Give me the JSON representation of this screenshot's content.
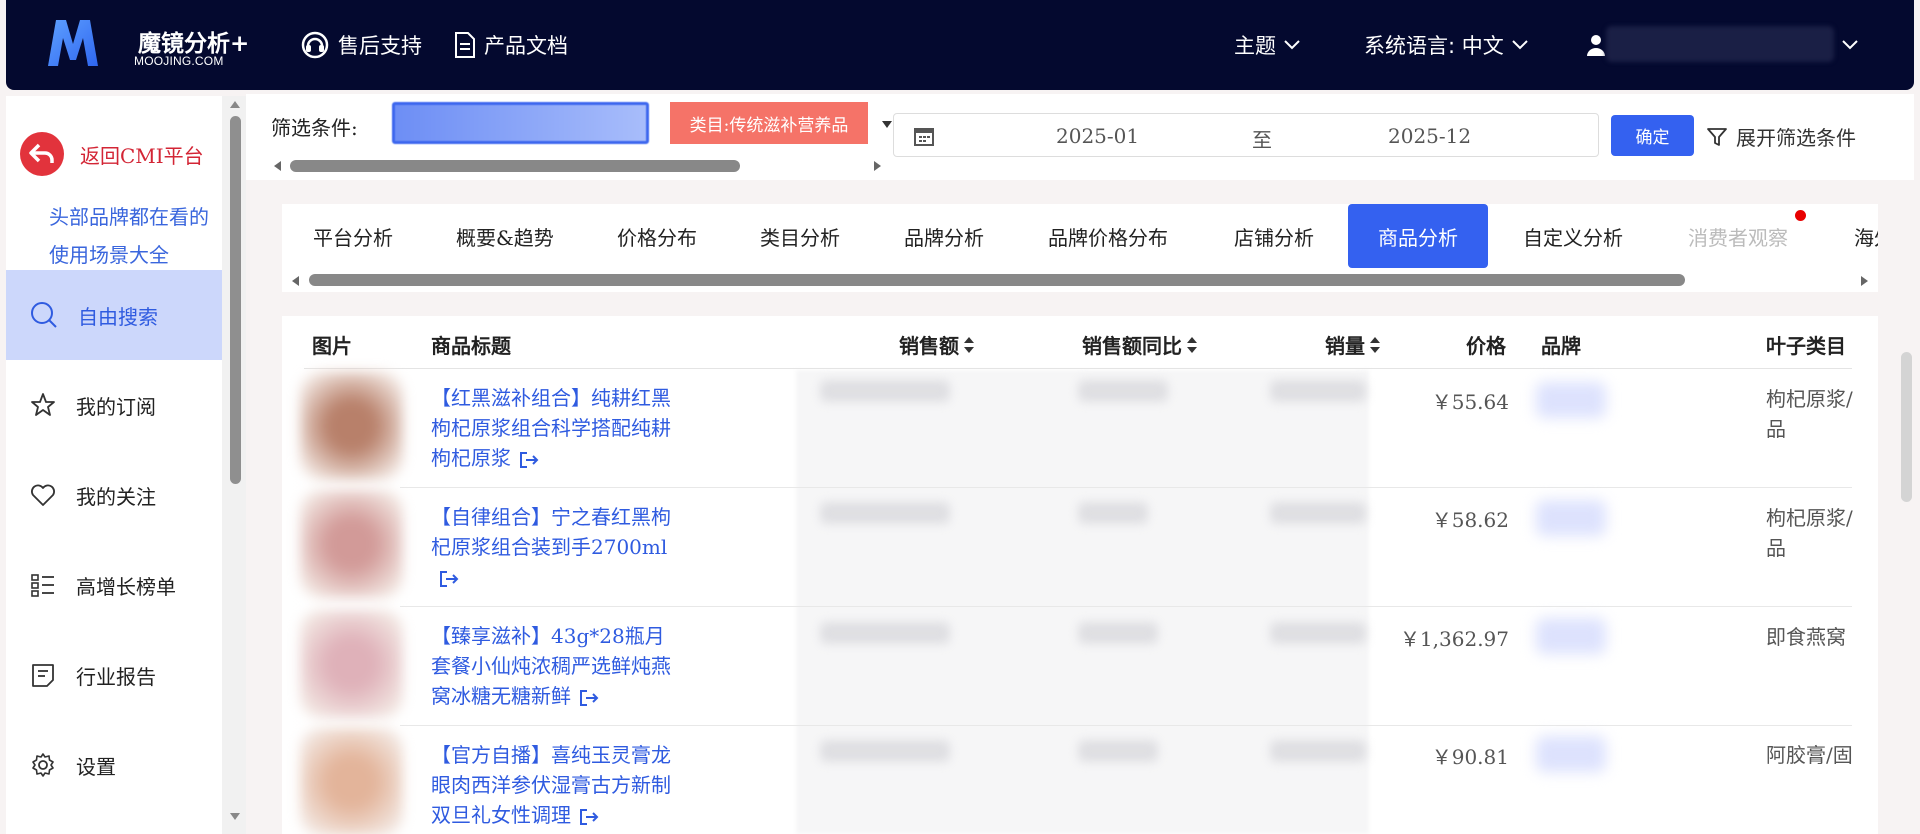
{
  "header": {
    "brand_name": "魔镜分析+",
    "brand_sub": "MOOJING.COM",
    "support": "售后支持",
    "docs": "产品文档",
    "theme": "主题",
    "language": "系统语言: 中文"
  },
  "sidebar": {
    "back": "返回CMI平台",
    "promo_line1": "头部品牌都在看的",
    "promo_line2": "使用场景大全",
    "items": [
      {
        "label": "自由搜索",
        "icon": "search-icon"
      },
      {
        "label": "我的订阅",
        "icon": "star-icon"
      },
      {
        "label": "我的关注",
        "icon": "heart-icon"
      },
      {
        "label": "高增长榜单",
        "icon": "list-icon"
      },
      {
        "label": "行业报告",
        "icon": "report-icon"
      },
      {
        "label": "设置",
        "icon": "gear-icon"
      }
    ]
  },
  "filter": {
    "label": "筛选条件:",
    "tag": "类目:传统滋补营养品",
    "date_start": "2025-01",
    "date_to": "至",
    "date_end": "2025-12",
    "confirm": "确定",
    "expand": "展开筛选条件"
  },
  "tabs": [
    "平台分析",
    "概要&趋势",
    "价格分布",
    "类目分析",
    "品牌分析",
    "品牌价格分布",
    "店铺分析",
    "商品分析",
    "自定义分析",
    "消费者观察",
    "海外"
  ],
  "active_tab": "商品分析",
  "table": {
    "headers": {
      "image": "图片",
      "title": "商品标题",
      "sales": "销售额",
      "yoy": "销售额同比",
      "volume": "销量",
      "price": "价格",
      "brand": "品牌",
      "leaf": "叶子类目"
    },
    "rows": [
      {
        "title": "【红黑滋补组合】纯耕红黑枸杞原浆组合科学搭配纯耕枸杞原浆",
        "price": "￥55.64",
        "leaf1": "枸杞原浆/",
        "leaf2": "品",
        "color": "#b8806a"
      },
      {
        "title": "【自律组合】宁之春红黑枸杞原浆组合装到手2700ml",
        "price": "￥58.62",
        "leaf1": "枸杞原浆/",
        "leaf2": "品",
        "color": "#d29a98"
      },
      {
        "title": "【臻享滋补】43g*28瓶月套餐小仙炖浓稠严选鲜炖燕窝冰糖无糖新鲜",
        "price": "￥1,362.97",
        "leaf1": "即食燕窝",
        "leaf2": "",
        "color": "#dfb1b9"
      },
      {
        "title": "【官方自播】喜纯玉灵膏龙眼肉西洋参伏湿膏古方新制双旦礼女性调理",
        "price": "￥90.81",
        "leaf1": "阿胶膏/固",
        "leaf2": "",
        "color": "#e3b49a"
      }
    ]
  }
}
